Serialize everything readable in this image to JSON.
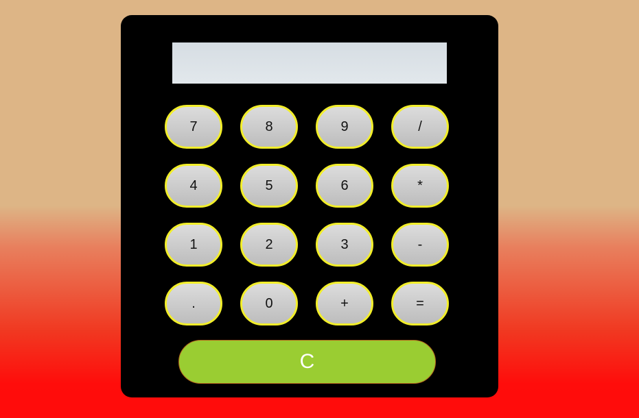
{
  "display": {
    "value": ""
  },
  "keys": {
    "row1": [
      "7",
      "8",
      "9",
      "/"
    ],
    "row2": [
      "4",
      "5",
      "6",
      "*"
    ],
    "row3": [
      "1",
      "2",
      "3",
      "-"
    ],
    "row4": [
      ".",
      "0",
      "+",
      "="
    ]
  },
  "clear_label": "C",
  "colors": {
    "background_top": "#ddb586",
    "background_bottom": "#ff0b0b",
    "calculator_body": "#000000",
    "key_border": "#f2ee2a",
    "clear_button": "#9acd32"
  }
}
